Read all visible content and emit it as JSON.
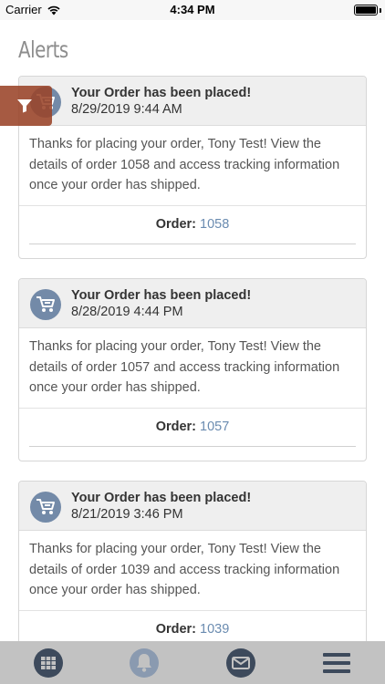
{
  "status_bar": {
    "carrier": "Carrier",
    "time": "4:34 PM"
  },
  "page": {
    "title": "Alerts"
  },
  "alerts": [
    {
      "title": "Your Order has been placed!",
      "date": "8/29/2019 9:44 AM",
      "message": "Thanks for placing your order, Tony Test! View the details of order 1058 and access tracking information once your order has shipped.",
      "order_label": "Order:",
      "order_number": "1058"
    },
    {
      "title": "Your Order has been placed!",
      "date": "8/28/2019 4:44 PM",
      "message": "Thanks for placing your order, Tony Test! View the details of order 1057 and access tracking information once your order has shipped.",
      "order_label": "Order:",
      "order_number": "1057"
    },
    {
      "title": "Your Order has been placed!",
      "date": "8/21/2019 3:46 PM",
      "message": "Thanks for placing your order, Tony Test! View the details of order 1039 and access tracking information once your order has shipped.",
      "order_label": "Order:",
      "order_number": "1039"
    }
  ],
  "icons": {
    "alert": "cart-icon",
    "filter": "filter-icon",
    "tabs": [
      "grid-icon",
      "bell-icon",
      "mail-icon",
      "menu-icon"
    ]
  },
  "colors": {
    "filter_button": "#9a4328",
    "icon_circle": "#738aa8",
    "link": "#6a8bb0",
    "tab_bar": "#c2c2c2",
    "tab_icon": "#3d4a5c"
  }
}
